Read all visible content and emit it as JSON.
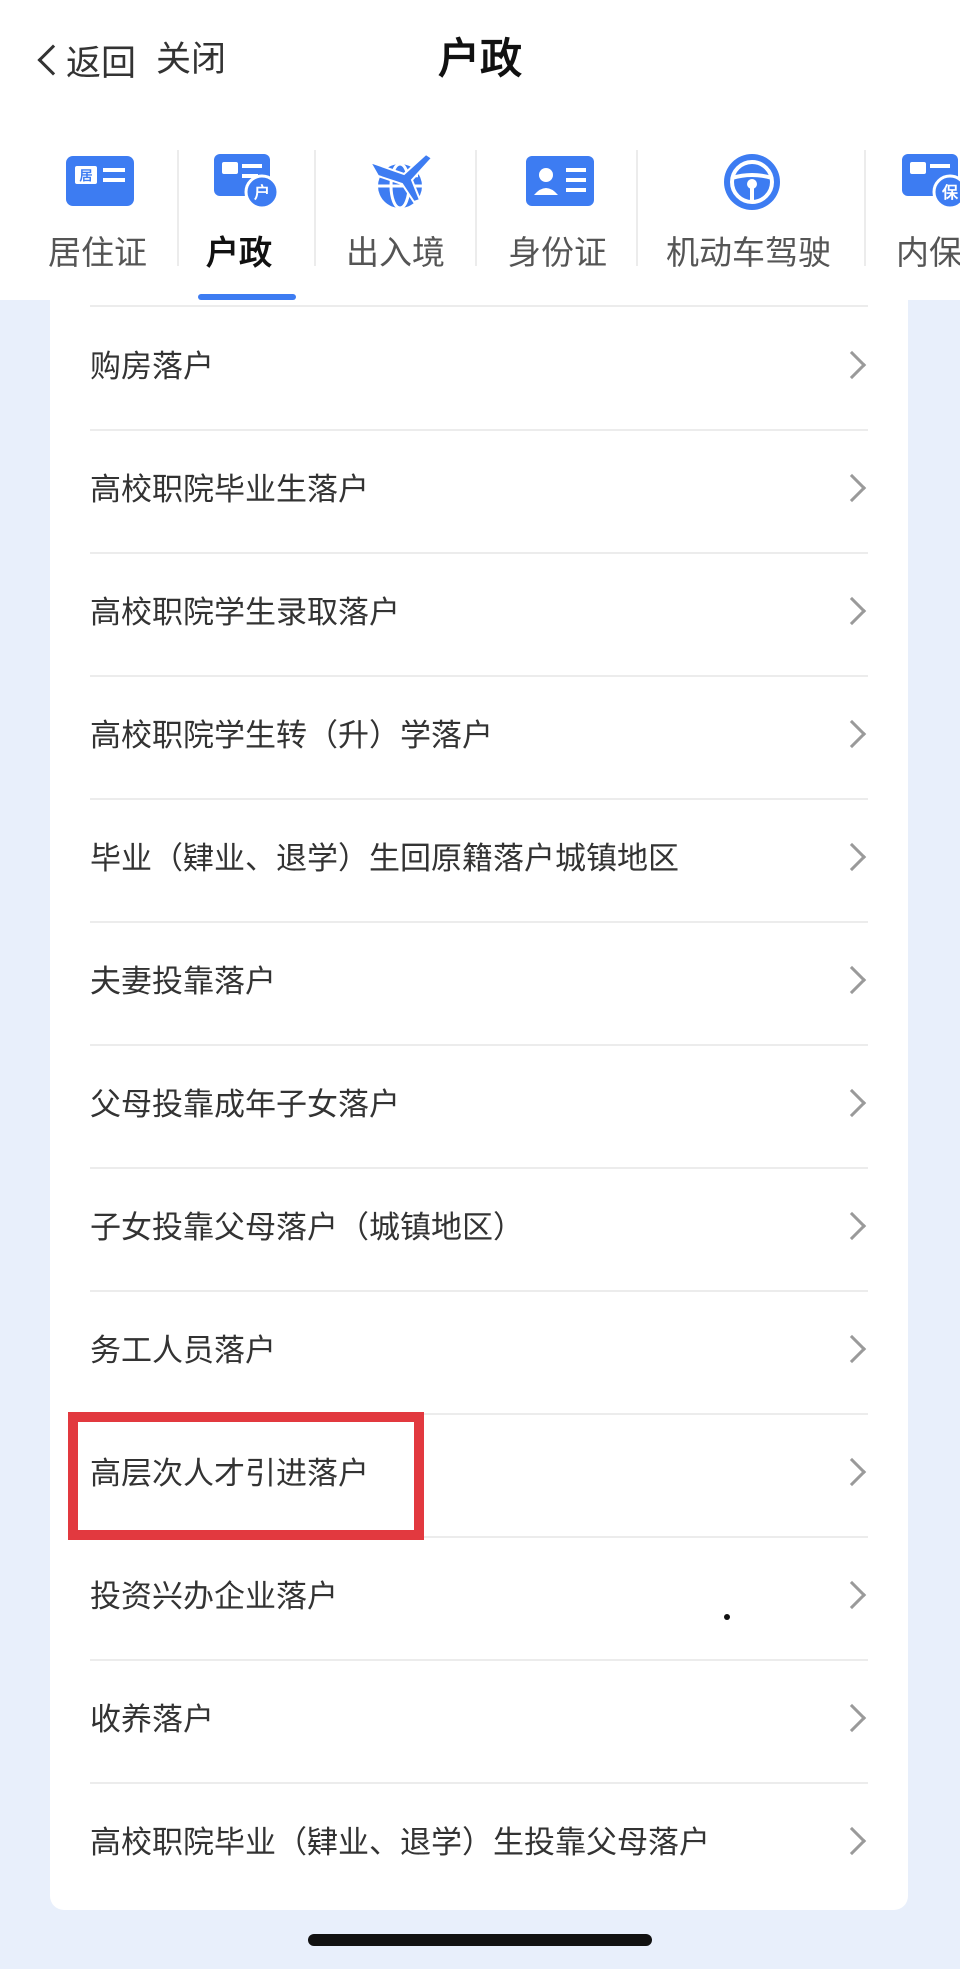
{
  "nav": {
    "back_label": "返回",
    "close_label": "关闭",
    "title": "户政"
  },
  "tabs": [
    {
      "label": "居住证",
      "icon": "residence-card-icon",
      "badge": "居"
    },
    {
      "label": "户政",
      "icon": "household-registration-icon",
      "badge": "户",
      "active": true
    },
    {
      "label": "出入境",
      "icon": "airplane-globe-icon"
    },
    {
      "label": "身份证",
      "icon": "id-card-icon"
    },
    {
      "label": "机动车驾驶",
      "icon": "steering-wheel-icon"
    },
    {
      "label": "内保",
      "icon": "internal-security-icon",
      "badge": "保"
    }
  ],
  "list": {
    "items": [
      "购房落户",
      "高校职院毕业生落户",
      "高校职院学生录取落户",
      "高校职院学生转（升）学落户",
      "毕业（肄业、退学）生回原籍落户城镇地区",
      "夫妻投靠落户",
      "父母投靠成年子女落户",
      "子女投靠父母落户（城镇地区）",
      "务工人员落户",
      "高层次人才引进落户",
      "投资兴办企业落户",
      "收养落户",
      "高校职院毕业（肄业、退学）生投靠父母落户"
    ],
    "highlighted_item": "高层次人才引进落户"
  },
  "colors": {
    "accent": "#3d7cf2",
    "highlight": "#e2393f",
    "page_background": "#e8effb"
  }
}
